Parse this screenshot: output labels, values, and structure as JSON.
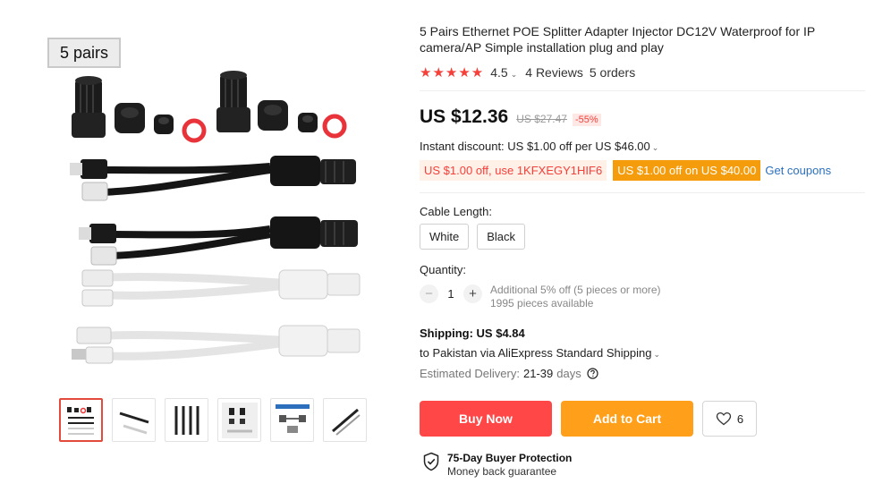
{
  "gallery": {
    "pack_tag": "5 pairs",
    "thumbnails": [
      {
        "name": "thumb-1"
      },
      {
        "name": "thumb-2"
      },
      {
        "name": "thumb-3"
      },
      {
        "name": "thumb-4"
      },
      {
        "name": "thumb-5"
      },
      {
        "name": "thumb-6"
      }
    ]
  },
  "product": {
    "title": "5 Pairs Ethernet POE Splitter Adapter Injector DC12V Waterproof for IP camera/AP Simple installation plug and play",
    "stars": "★★★★★",
    "rating": "4.5",
    "reviews": "4 Reviews",
    "orders": "5 orders"
  },
  "price": {
    "current": "US $12.36",
    "original": "US $27.47",
    "discount": "-55%"
  },
  "promotions": {
    "instant_discount": "Instant discount: US $1.00 off per US $46.00",
    "coupon_code": "US $1.00 off, use 1KFXEGY1HIF6",
    "store_coupon": "US $1.00 off on US $40.00",
    "get_coupons": "Get coupons"
  },
  "variants": {
    "label": "Cable Length:",
    "options": [
      "White",
      "Black"
    ]
  },
  "quantity": {
    "label": "Quantity:",
    "minus": "−",
    "value": "1",
    "plus": "+",
    "bulk_discount": "Additional 5% off (5 pieces or more)",
    "available": "1995 pieces available"
  },
  "shipping": {
    "title": "Shipping: US $4.84",
    "method": "to Pakistan via AliExpress Standard Shipping",
    "estimated_label": "Estimated Delivery:",
    "estimated_days": "21-39",
    "estimated_unit": "days"
  },
  "actions": {
    "buy_now": "Buy Now",
    "add_to_cart": "Add to Cart",
    "wishlist_count": "6"
  },
  "protection": {
    "title": "75-Day Buyer Protection",
    "subtitle": "Money back guarantee"
  },
  "colors": {
    "accent_red": "#ff4747",
    "accent_orange": "#ff9f1a",
    "link_blue": "#2b6fbd"
  }
}
